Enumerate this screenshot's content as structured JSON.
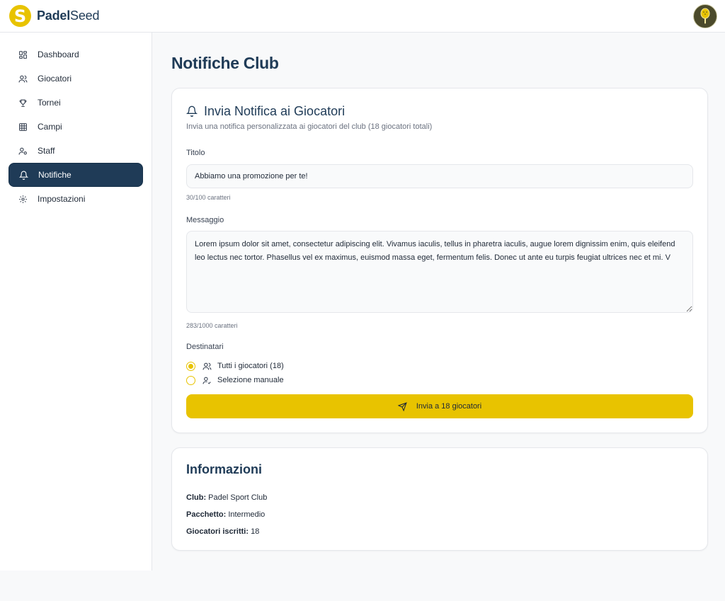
{
  "header": {
    "logo_letter": "S",
    "brand_bold": "Padel",
    "brand_regular": "Seed",
    "avatar_icon": "padel-racket-icon"
  },
  "sidebar": {
    "items": [
      {
        "label": "Dashboard",
        "icon": "dashboard-icon",
        "active": false
      },
      {
        "label": "Giocatori",
        "icon": "users-icon",
        "active": false
      },
      {
        "label": "Tornei",
        "icon": "trophy-icon",
        "active": false
      },
      {
        "label": "Campi",
        "icon": "grid-icon",
        "active": false
      },
      {
        "label": "Staff",
        "icon": "staff-icon",
        "active": false
      },
      {
        "label": "Notifiche",
        "icon": "bell-icon",
        "active": true
      },
      {
        "label": "Impostazioni",
        "icon": "gear-icon",
        "active": false
      }
    ]
  },
  "page": {
    "title": "Notifiche Club"
  },
  "notify": {
    "title": "Invia Notifica ai Giocatori",
    "subtitle": "Invia una notifica personalizzata ai giocatori del club (18 giocatori totali)",
    "title_label": "Titolo",
    "title_value": "Abbiamo una promozione per te!",
    "title_counter": "30/100 caratteri",
    "message_label": "Messaggio",
    "message_value": "Lorem ipsum dolor sit amet, consectetur adipiscing elit. Vivamus iaculis, tellus in pharetra iaculis, augue lorem dignissim enim, quis eleifend leo lectus nec tortor. Phasellus vel ex maximus, euismod massa eget, fermentum felis. Donec ut ante eu turpis feugiat ultrices nec et mi. V",
    "message_counter": "283/1000 caratteri",
    "recipients_label": "Destinatari",
    "option_all": "Tutti i giocatori (18)",
    "option_manual": "Selezione manuale",
    "selected_option": "all",
    "send_label": "Invia a 18 giocatori"
  },
  "info": {
    "title": "Informazioni",
    "club_label": "Club:",
    "club_value": "Padel Sport Club",
    "package_label": "Pacchetto:",
    "package_value": "Intermedio",
    "players_label": "Giocatori iscritti:",
    "players_value": "18"
  },
  "colors": {
    "primary": "#1f3b57",
    "accent": "#e8c300"
  }
}
